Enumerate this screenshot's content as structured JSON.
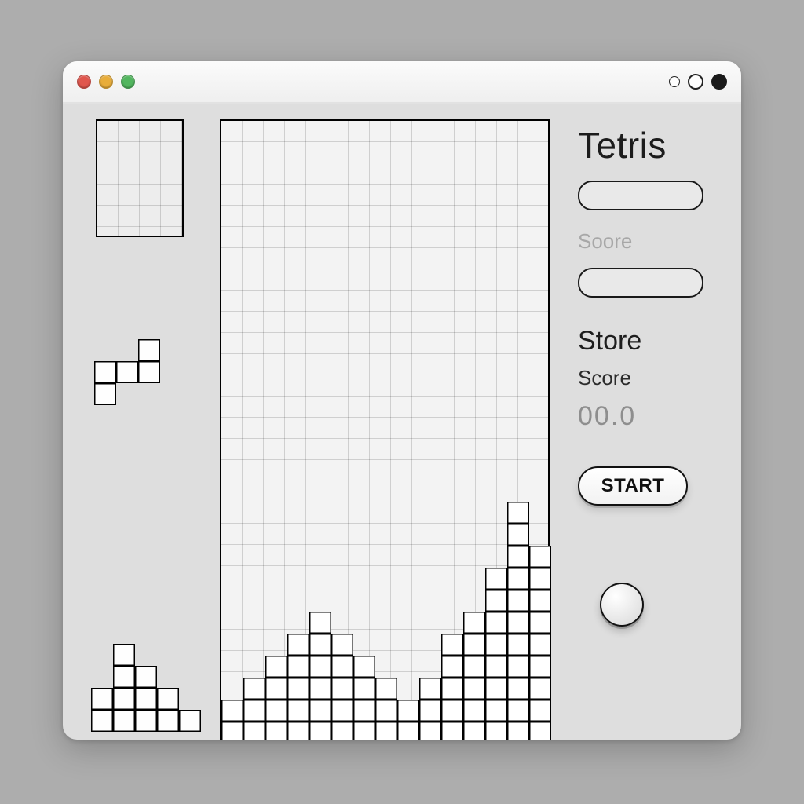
{
  "window": {
    "traffic_colors": {
      "close": "#e0564d",
      "minimize": "#e8ad3a",
      "maximize": "#52b65f"
    }
  },
  "game": {
    "title": "Tetris",
    "score_label_faint": "Soore",
    "store_label": "Store",
    "score_label": "Score",
    "score_value": "00.0",
    "start_label": "START"
  },
  "board": {
    "cols": 15,
    "rows_visible": 28,
    "filled_rows_bottom_up": [
      [
        1,
        1,
        1,
        1,
        1,
        1,
        1,
        1,
        1,
        1,
        1,
        1,
        1,
        1,
        1
      ],
      [
        1,
        1,
        1,
        1,
        1,
        1,
        1,
        1,
        1,
        1,
        1,
        1,
        1,
        1,
        1
      ],
      [
        0,
        1,
        1,
        1,
        1,
        1,
        1,
        1,
        0,
        1,
        1,
        1,
        1,
        1,
        1
      ],
      [
        0,
        0,
        1,
        1,
        1,
        1,
        1,
        0,
        0,
        0,
        1,
        1,
        1,
        1,
        1
      ],
      [
        0,
        0,
        0,
        1,
        1,
        1,
        0,
        0,
        0,
        0,
        1,
        1,
        1,
        1,
        1
      ],
      [
        0,
        0,
        0,
        0,
        1,
        0,
        0,
        0,
        0,
        0,
        0,
        1,
        1,
        1,
        1
      ],
      [
        0,
        0,
        0,
        0,
        0,
        0,
        0,
        0,
        0,
        0,
        0,
        0,
        1,
        1,
        1
      ],
      [
        0,
        0,
        0,
        0,
        0,
        0,
        0,
        0,
        0,
        0,
        0,
        0,
        1,
        1,
        1
      ],
      [
        0,
        0,
        0,
        0,
        0,
        0,
        0,
        0,
        0,
        0,
        0,
        0,
        0,
        1,
        1
      ],
      [
        0,
        0,
        0,
        0,
        0,
        0,
        0,
        0,
        0,
        0,
        0,
        0,
        0,
        1,
        0
      ],
      [
        0,
        0,
        0,
        0,
        0,
        0,
        0,
        0,
        0,
        0,
        0,
        0,
        0,
        1,
        0
      ]
    ]
  },
  "queue_piece": {
    "shape_name": "S-piece",
    "grid": [
      [
        0,
        0,
        1
      ],
      [
        1,
        1,
        1
      ],
      [
        1,
        0,
        0
      ]
    ]
  },
  "loose_pile": {
    "grid_bottom_up": [
      [
        1,
        1,
        1,
        1,
        1
      ],
      [
        1,
        1,
        1,
        1,
        0
      ],
      [
        0,
        1,
        1,
        0,
        0
      ],
      [
        0,
        1,
        0,
        0,
        0
      ]
    ]
  }
}
